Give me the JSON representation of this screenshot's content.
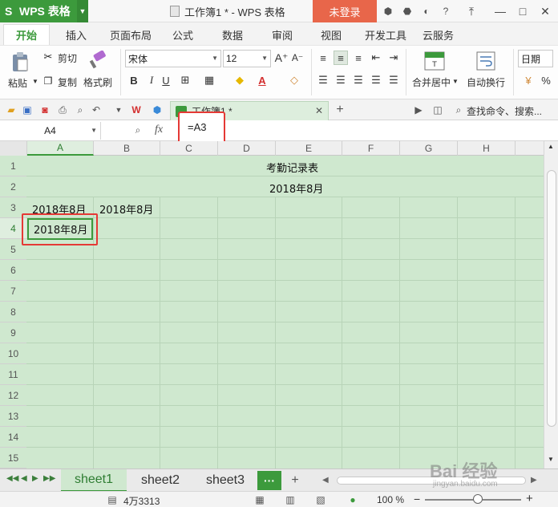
{
  "titlebar": {
    "app_name": "WPS 表格",
    "logo_glyph": "S",
    "document_title": "工作簿1 * - WPS 表格",
    "login_label": "未登录"
  },
  "ribbon_tabs": [
    "开始",
    "插入",
    "页面布局",
    "公式",
    "数据",
    "审阅",
    "视图",
    "开发工具",
    "云服务"
  ],
  "ribbon": {
    "paste_label": "粘贴",
    "cut_label": "剪切",
    "copy_label": "复制",
    "format_painter_label": "格式刷",
    "font_name": "宋体",
    "font_size": "12",
    "merge_center_label": "合并居中",
    "wrap_text_label": "自动换行",
    "number_format": "日期"
  },
  "quickbar": {
    "doc_tab_label": "工作簿1 *",
    "search_label": "查找命令、搜索..."
  },
  "formula_bar": {
    "cell_ref": "A4",
    "fx_label": "fx",
    "formula": "=A3"
  },
  "grid": {
    "columns": [
      "A",
      "B",
      "C",
      "D",
      "E",
      "F",
      "G",
      "H"
    ],
    "rows": [
      "1",
      "2",
      "3",
      "4",
      "5",
      "6",
      "7",
      "8",
      "9",
      "10",
      "11",
      "12",
      "13",
      "14",
      "15"
    ],
    "cells": {
      "title": "考勤记录表",
      "month_header": "2018年8月",
      "a3": "2018年8月",
      "b3": "2018年8月",
      "a4": "2018年8月"
    }
  },
  "sheets": [
    "sheet1",
    "sheet2",
    "sheet3"
  ],
  "active_sheet": "sheet1",
  "statusbar": {
    "count_text": "4万3313",
    "zoom": "100 %",
    "zoom_minus": "−",
    "zoom_plus": "+"
  },
  "watermark": {
    "text": "Bai 经验",
    "sub": "jingyan.baidu.com"
  },
  "colors": {
    "brand_green": "#3c9a3c",
    "login_orange": "#e8664a",
    "highlight_red": "#e53935",
    "grid_green": "#cfe8cf"
  }
}
